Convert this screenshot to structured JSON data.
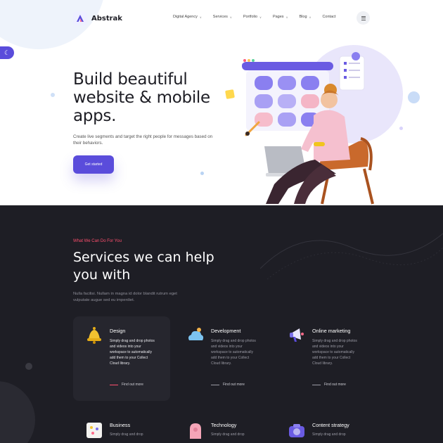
{
  "brand": {
    "name": "Abstrak",
    "accent": "#5a4cdb",
    "highlight": "#ff4f6e",
    "dark_bg": "#1e1e25"
  },
  "header": {
    "nav": [
      {
        "label": "Digital Agency",
        "has_dropdown": true
      },
      {
        "label": "Services",
        "has_dropdown": true
      },
      {
        "label": "Portfolio",
        "has_dropdown": true
      },
      {
        "label": "Pages",
        "has_dropdown": true
      },
      {
        "label": "Blog",
        "has_dropdown": true
      },
      {
        "label": "Contact",
        "has_dropdown": false
      }
    ],
    "menu_icon": "hamburger-icon",
    "dark_toggle_icon": "moon-icon"
  },
  "hero": {
    "title": "Build beautiful website & mobile apps.",
    "description": "Create live segments and target the right people for messages based on their behaviors.",
    "cta_label": "Get started"
  },
  "services": {
    "eyebrow": "What We Can Do For You",
    "title": "Services we can help you with",
    "description": "Nulla facilisi. Nullam in magna id dolor blandit rutrum eget vulputate augue sed eu imperdiet.",
    "items": [
      {
        "title": "Design",
        "text": "Simply drag and drop photos and videos into your workspace to automatically add them to your Collect Cloud library.",
        "link": "Find out more",
        "icon": "bell-icon",
        "active": true
      },
      {
        "title": "Development",
        "text": "Simply drag and drop photos and videos into your workspace to automatically add them to your Collect Cloud library.",
        "link": "Find out more",
        "icon": "cloud-icon",
        "active": false
      },
      {
        "title": "Online marketing",
        "text": "Simply drag and drop photos and videos into your workspace to automatically add them to your Collect Cloud library.",
        "link": "Find out more",
        "icon": "megaphone-icon",
        "active": false
      },
      {
        "title": "Business",
        "text": "Simply drag and drop",
        "icon": "chart-board-icon"
      },
      {
        "title": "Technology",
        "text": "Simply drag and drop",
        "icon": "chip-icon"
      },
      {
        "title": "Content strategy",
        "text": "Simply drag and drop",
        "icon": "camera-icon"
      }
    ]
  }
}
